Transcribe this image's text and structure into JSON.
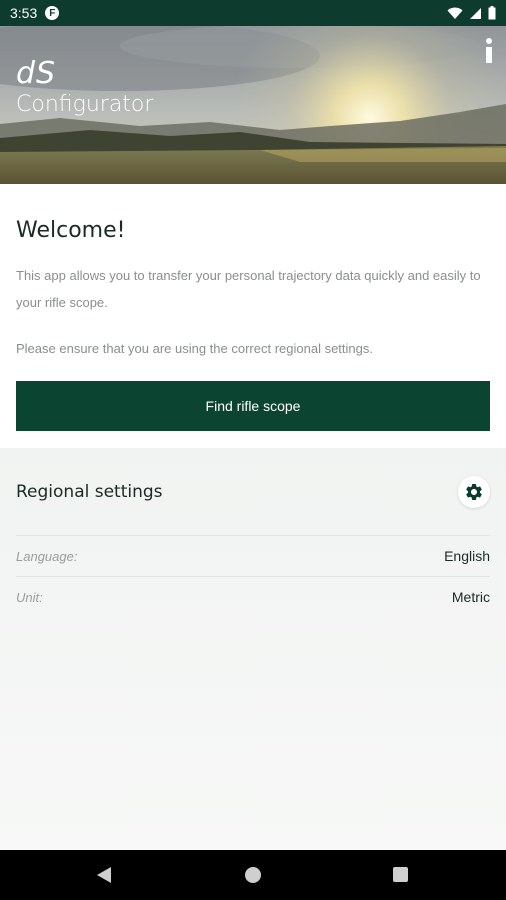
{
  "status_bar": {
    "time": "3:53",
    "notification_glyph": "F",
    "icons": [
      "wifi-icon",
      "signal-icon",
      "battery-icon"
    ]
  },
  "header": {
    "logo_line1": "dS",
    "logo_line2": "Configurator",
    "info_icon": "info-icon"
  },
  "welcome": {
    "title": "Welcome!",
    "body": "This app allows you to transfer your personal trajectory data quickly and easily to your rifle scope.",
    "note": "Please ensure that you are using the correct regional settings.",
    "find_button": "Find rifle scope"
  },
  "regional": {
    "title": "Regional settings",
    "settings_icon": "gear-icon",
    "rows": [
      {
        "label": "Language:",
        "value": "English"
      },
      {
        "label": "Unit:",
        "value": "Metric"
      }
    ]
  },
  "nav": {
    "icons": [
      "back-icon",
      "home-icon",
      "recents-icon"
    ]
  },
  "colors": {
    "brand_dark_green": "#0b4532",
    "status_bar": "#0d3b2e",
    "panel_background": "#f4f5f4"
  }
}
